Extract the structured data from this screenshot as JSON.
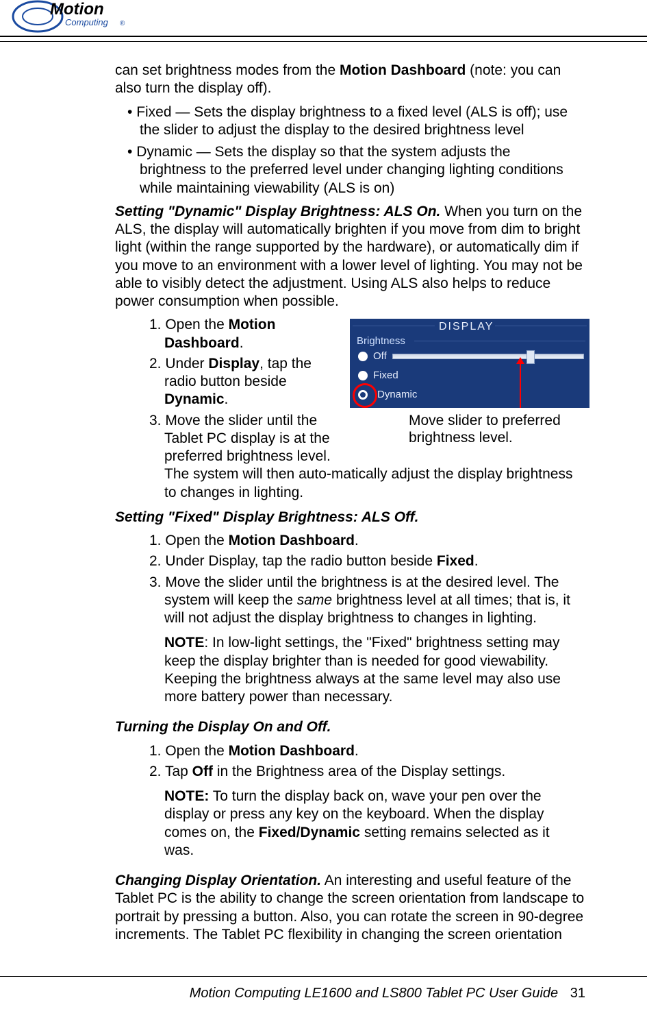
{
  "logo": {
    "brand_top": "Motion",
    "brand_bottom": "Computing",
    "registered": "®"
  },
  "intro": {
    "p1_a": "can set brightness modes from the ",
    "p1_b": "Motion Dashboard",
    "p1_c": " (note: you can also turn the display off)."
  },
  "bullets": {
    "b1": "Fixed — Sets the display brightness to a fixed level (ALS is off); use the slider to adjust the display to the desired brightness level",
    "b2": "Dynamic — Sets the display so that the system adjusts the brightness to the preferred level under changing lighting conditions while maintaining viewability (ALS is on)"
  },
  "dyn_heading": "Setting \"Dynamic\" Display Brightness: ALS On.",
  "dyn_para": " When you turn on the ALS, the display will automatically brighten if you move from dim to bright light (within the range supported by the hardware), or automatically dim if you move to an environment with a lower level of lighting. You may not be able to visibly detect the adjustment. Using ALS also helps to reduce power consumption when possible.",
  "dyn_steps": {
    "s1_a": "1. Open the ",
    "s1_b": "Motion Dashboard",
    "s1_c": ".",
    "s2_a": "2. Under ",
    "s2_b": "Display",
    "s2_c": ", tap the radio button beside ",
    "s2_d": "Dynamic",
    "s2_e": ".",
    "s3": "3. Move the slider until the Tablet PC display is at the preferred brightness level. The system will then auto-matically adjust the display brightness to changes in lighting."
  },
  "figure": {
    "panel_title": "DISPLAY",
    "section_label": "Brightness",
    "opt_off": "Off",
    "opt_fixed": "Fixed",
    "opt_dynamic": "Dynamic",
    "caption": "Move slider to preferred brightness level."
  },
  "fixed_heading": "Setting \"Fixed\" Display Brightness: ALS Off.",
  "fixed_steps": {
    "s1_a": "1. Open the ",
    "s1_b": "Motion Dashboard",
    "s1_c": ".",
    "s2_a": "2. Under Display, tap the radio button beside ",
    "s2_b": "Fixed",
    "s2_c": ".",
    "s3_a": "3. Move the slider until the brightness is at the desired level. The system will keep the ",
    "s3_b": "same",
    "s3_c": " brightness level at all times; that is, it will not adjust the display brightness to changes in lighting."
  },
  "note1_label": "NOTE",
  "note1_body": ": In low-light settings, the \"Fixed\" brightness setting may keep the display brighter than is needed for good viewability. Keeping the brightness always at the same level may also use more battery power than necessary.",
  "onoff_heading": "Turning the Display On and Off.",
  "onoff_steps": {
    "s1_a": "1. Open the ",
    "s1_b": "Motion Dashboard",
    "s1_c": ".",
    "s2_a": "2. Tap ",
    "s2_b": "Off",
    "s2_c": " in the Brightness area of the Display settings."
  },
  "note2_label": "NOTE:",
  "note2_a": " To turn the display back on, wave your pen over the display or press any key on the keyboard. When the display comes on, the ",
  "note2_b": "Fixed/Dynamic",
  "note2_c": " setting remains selected as it was.",
  "orient_heading": "Changing Display Orientation.",
  "orient_body": " An interesting and useful feature of the Tablet PC is the ability to change the screen orientation from landscape to portrait by pressing a button. Also, you can rotate the screen in 90-degree increments. The Tablet PC flexibility in changing the screen orientation",
  "footer": {
    "title": "Motion Computing LE1600 and LS800 Tablet PC User Guide",
    "page": "31"
  }
}
